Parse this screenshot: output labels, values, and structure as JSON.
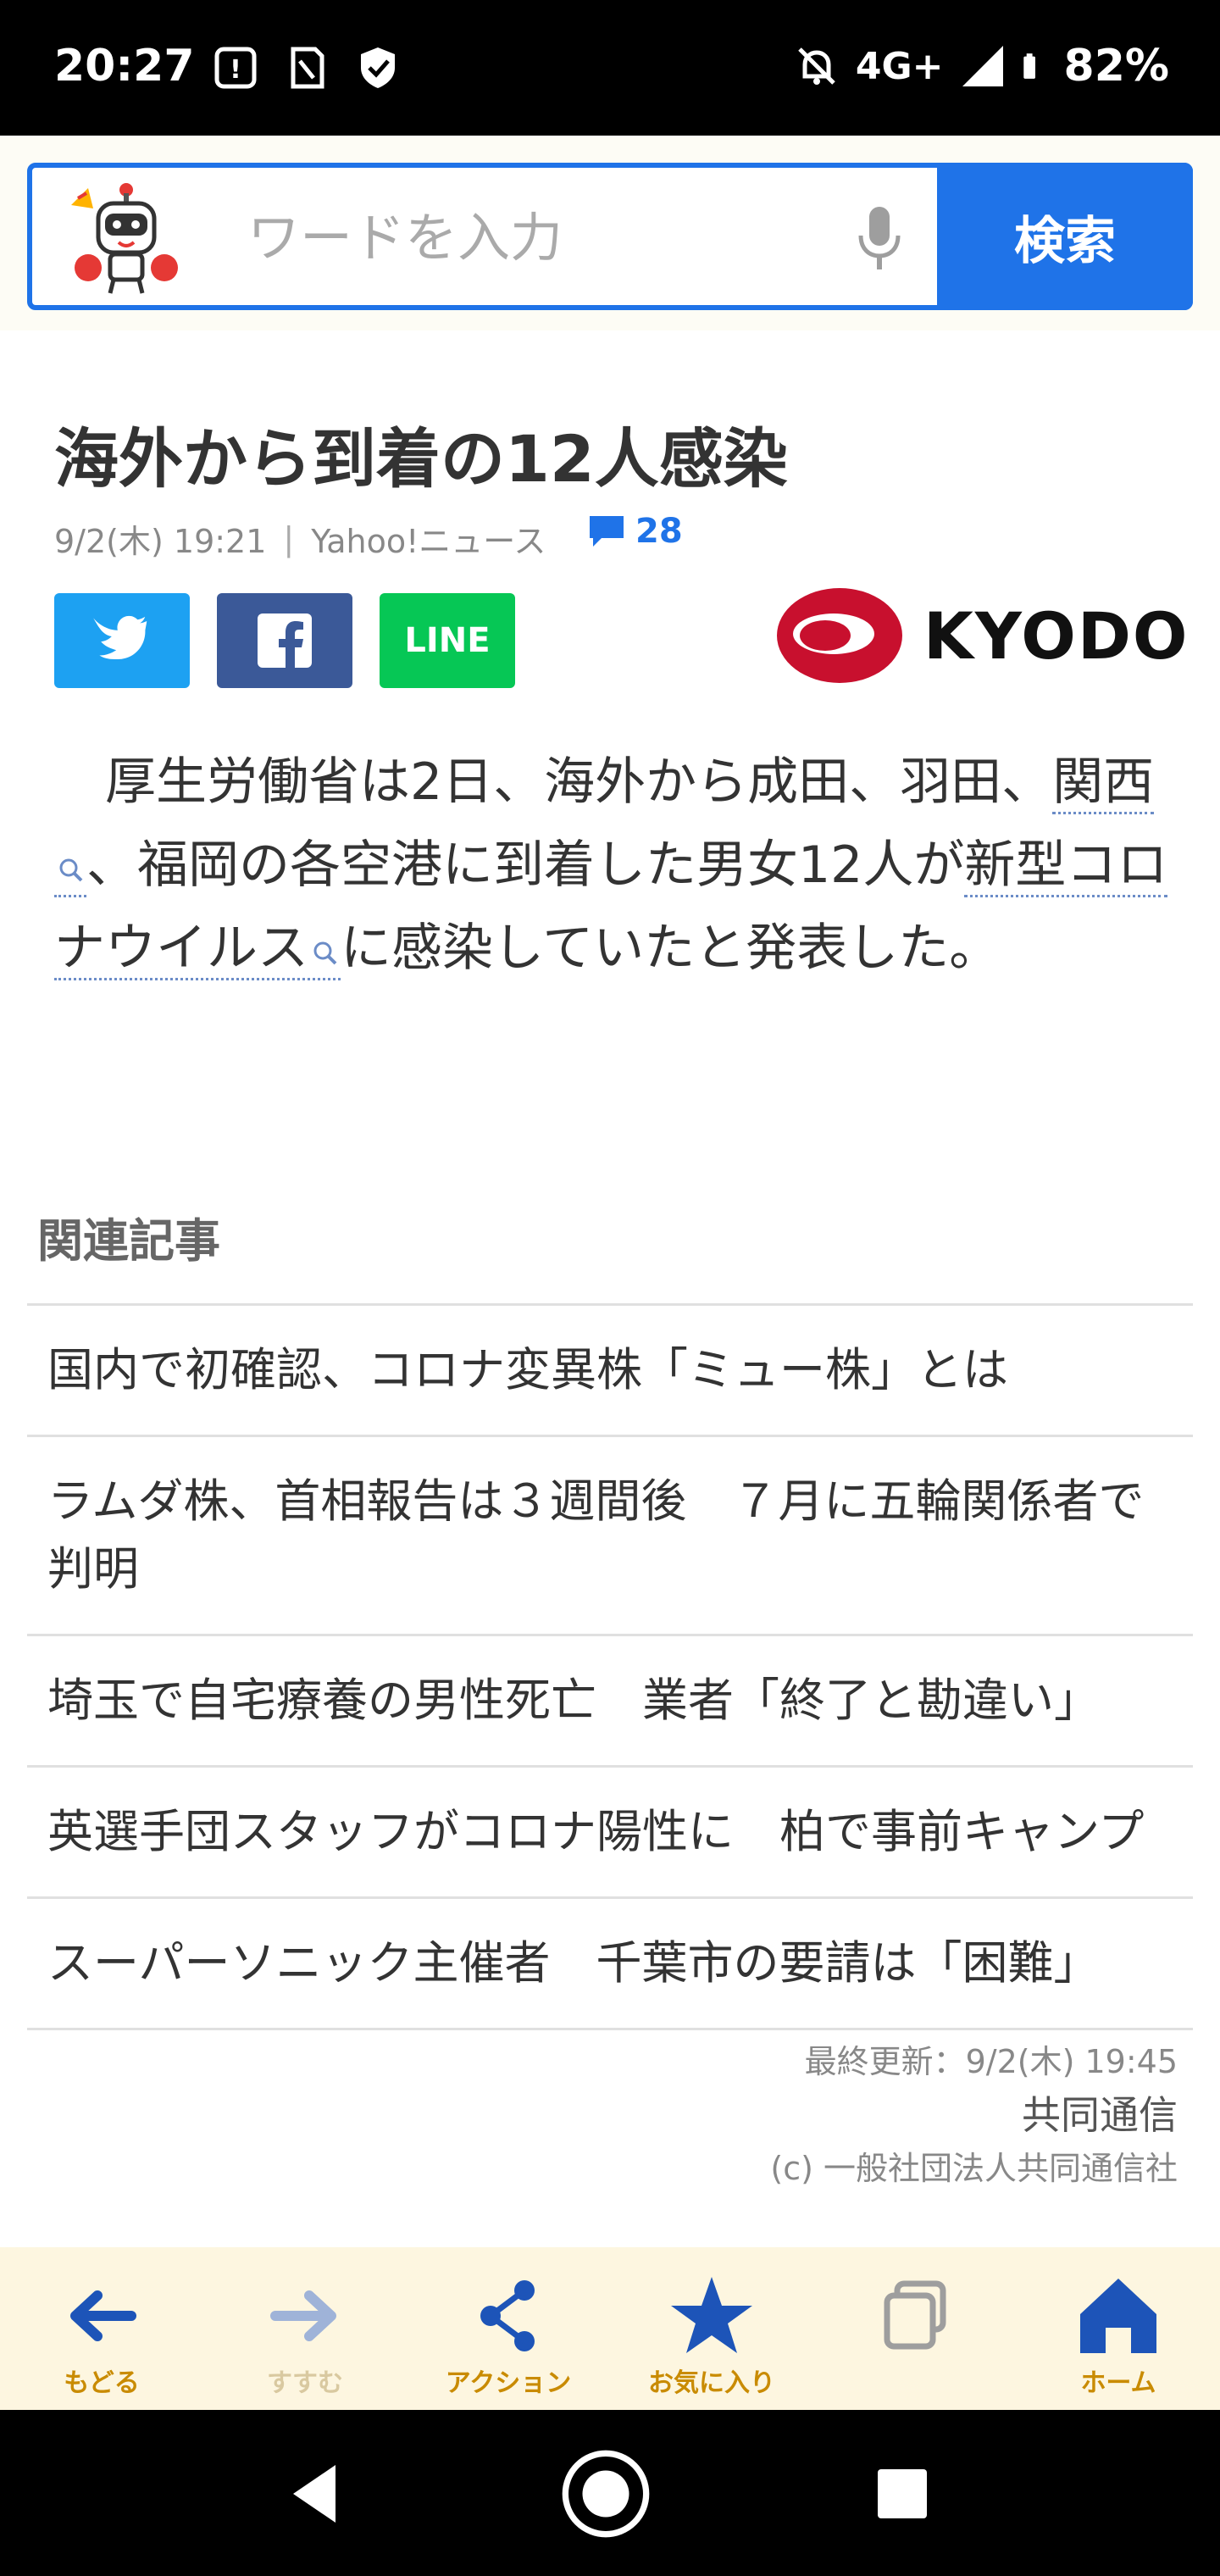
{
  "status_bar": {
    "time": "20:27",
    "network": "4G+",
    "battery": "82%"
  },
  "search": {
    "placeholder": "ワードを入力",
    "button_label": "検索"
  },
  "article": {
    "title": "海外から到着の12人感染",
    "date": "9/2(木) 19:21",
    "source": "Yahoo!ニュース",
    "comment_count": "28",
    "share": {
      "line_label": "LINE"
    },
    "provider_logo_text": "KYODO",
    "body_parts": {
      "p1": "　厚生労働省は2日、海外から成田、羽田、",
      "kw1": "関西",
      "p2": "、福岡の各空港に到着した男女12人が",
      "kw2": "新型コロナウイルス",
      "p3": "に感染していたと発表した。"
    }
  },
  "related": {
    "heading": "関連記事",
    "items": [
      "国内で初確認、コロナ変異株「ミュー株」とは",
      "ラムダ株、首相報告は３週間後　７月に五輪関係者で判明",
      "埼玉で自宅療養の男性死亡　業者「終了と勘違い」",
      "英選手団スタッフがコロナ陽性に　柏で事前キャンプ",
      "スーパーソニック主催者　千葉市の要請は「困難」"
    ]
  },
  "footer": {
    "last_updated": "最終更新：9/2(木) 19:45",
    "source": "共同通信",
    "copyright": "(c) 一般社団法人共同通信社"
  },
  "bottom_nav": {
    "back": "もどる",
    "forward": "すすむ",
    "action": "アクション",
    "favorites": "お気に入り",
    "tabs": "",
    "home": "ホーム"
  },
  "colors": {
    "accent": "#1f73e8",
    "nav_label": "#c98b00",
    "nav_icon": "#1d54b8",
    "twitter": "#1da1f2",
    "facebook": "#3b5998",
    "line": "#06c755",
    "kyodo_red": "#c8102e"
  }
}
